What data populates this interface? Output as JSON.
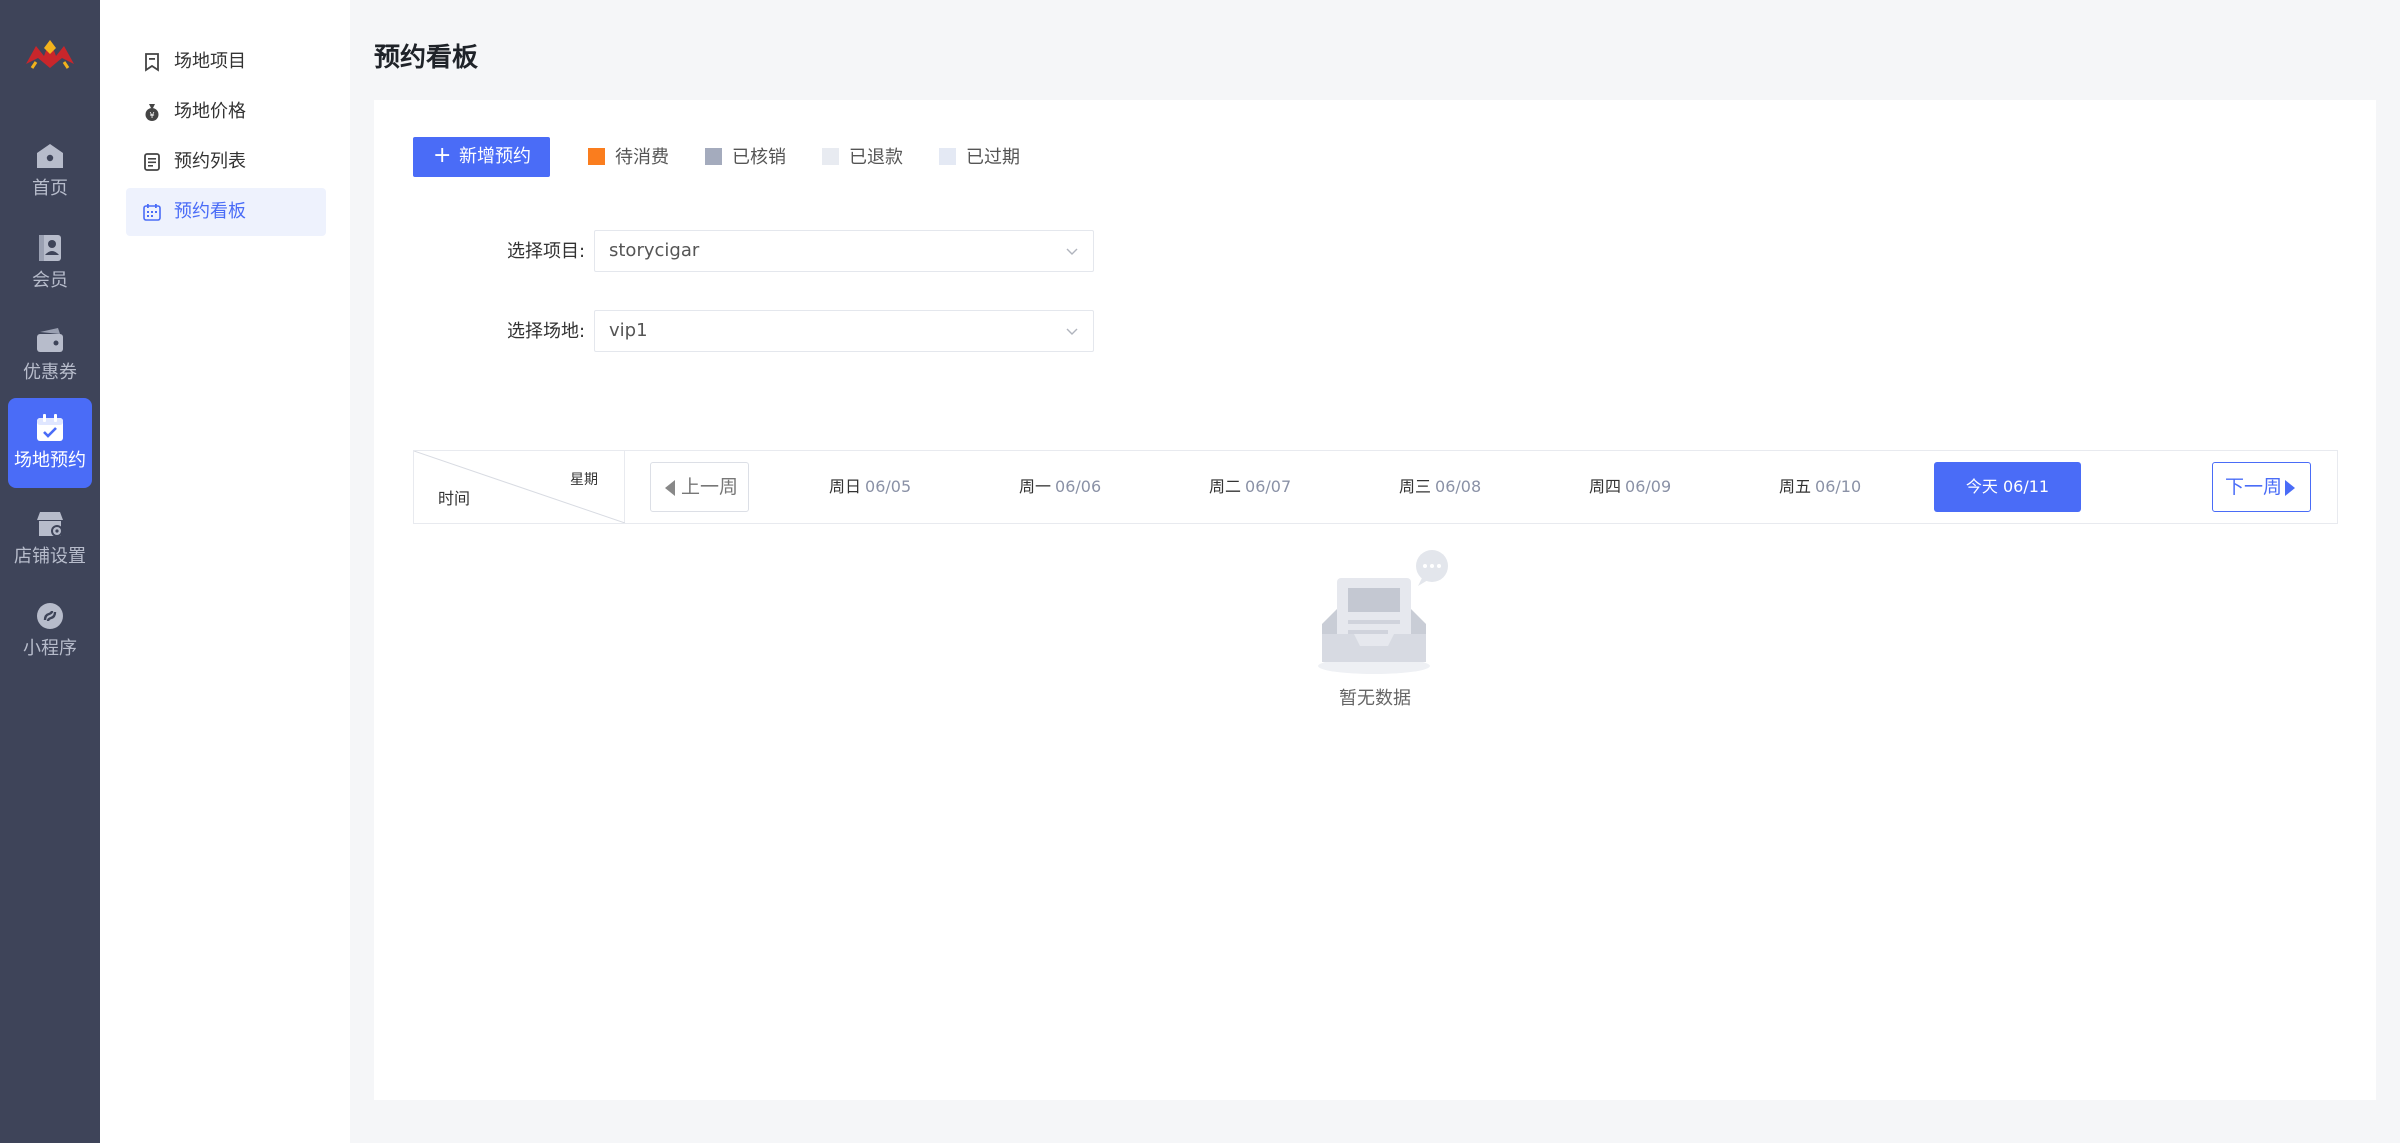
{
  "rail": {
    "items": [
      {
        "label": "首页",
        "icon": "home-icon"
      },
      {
        "label": "会员",
        "icon": "member-icon"
      },
      {
        "label": "优惠券",
        "icon": "coupon-icon"
      },
      {
        "label": "场地预约",
        "icon": "calendar-check-icon",
        "active": true
      },
      {
        "label": "店铺设置",
        "icon": "store-settings-icon"
      },
      {
        "label": "小程序",
        "icon": "mini-program-icon"
      }
    ]
  },
  "submenu": {
    "items": [
      {
        "label": "场地项目",
        "icon": "bookmark-icon"
      },
      {
        "label": "场地价格",
        "icon": "money-bag-icon"
      },
      {
        "label": "预约列表",
        "icon": "list-icon"
      },
      {
        "label": "预约看板",
        "icon": "calendar-grid-icon",
        "active": true
      }
    ]
  },
  "page": {
    "title": "预约看板"
  },
  "toolbar": {
    "add_label": "新增预约"
  },
  "legend": [
    {
      "label": "待消费",
      "color": "#fa7d1e"
    },
    {
      "label": "已核销",
      "color": "#a4abbd"
    },
    {
      "label": "已退款",
      "color": "#e8ebf1"
    },
    {
      "label": "已过期",
      "color": "#e4e9f4"
    }
  ],
  "form": {
    "project_label": "选择项目:",
    "project_value": "storycigar",
    "venue_label": "选择场地:",
    "venue_value": "vip1"
  },
  "week": {
    "corner_row": "时间",
    "corner_col": "星期",
    "prev_label": "上一周",
    "next_label": "下一周",
    "days": [
      {
        "name": "周日",
        "date": "06/05"
      },
      {
        "name": "周一",
        "date": "06/06"
      },
      {
        "name": "周二",
        "date": "06/07"
      },
      {
        "name": "周三",
        "date": "06/08"
      },
      {
        "name": "周四",
        "date": "06/09"
      },
      {
        "name": "周五",
        "date": "06/10"
      }
    ],
    "today_label": "今天 06/11"
  },
  "empty": {
    "text": "暂无数据"
  },
  "colors": {
    "accent": "#4a6cf7",
    "rail_bg": "#3e4459"
  }
}
